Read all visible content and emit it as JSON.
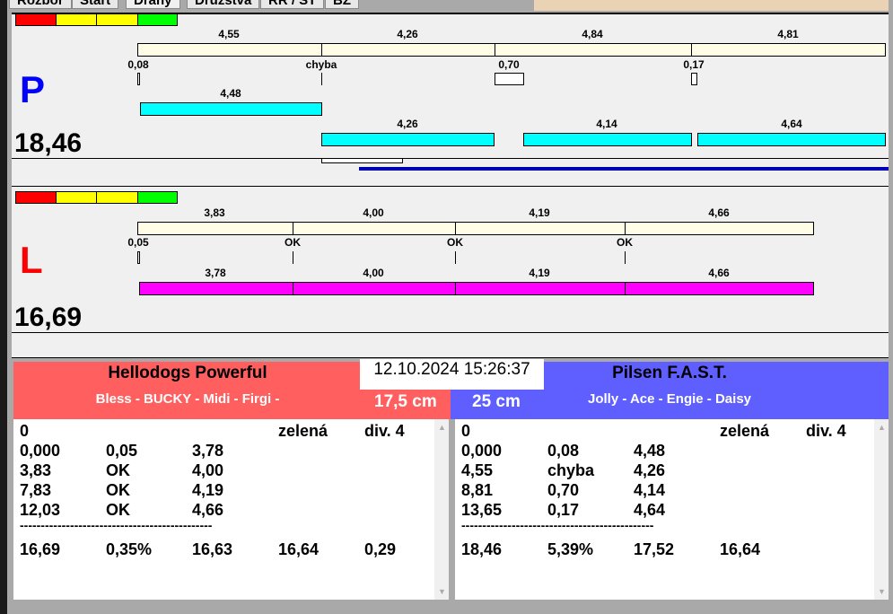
{
  "tabs": [
    "Rozbor",
    "Start",
    "Dráhy",
    "Družstva",
    "RR / ST",
    "BZ"
  ],
  "colors": {
    "red": "#ff0000",
    "yellow": "#ffff00",
    "green": "#00ff00",
    "lane_p": "#0000ff",
    "lane_l": "#ff0000",
    "cyan": "#00ffff",
    "magenta": "#ff00ff",
    "cream": "#fffde6",
    "team_left_bg": "#ff5f5f",
    "team_right_bg": "#5f5fff"
  },
  "lane_p": {
    "letter": "P",
    "total": "18,46",
    "top_values": [
      "4,55",
      "4,26",
      "4,84",
      "4,81"
    ],
    "checks": [
      "0,08",
      "chyba",
      "0,70",
      "0,17"
    ],
    "row1_values": [
      "4,48"
    ],
    "row2_values": [
      "4,26",
      "4,14",
      "4,64"
    ]
  },
  "lane_l": {
    "letter": "L",
    "total": "16,69",
    "top_values": [
      "3,83",
      "4,00",
      "4,19",
      "4,66"
    ],
    "checks": [
      "0,05",
      "OK",
      "OK",
      "OK"
    ],
    "row_values": [
      "3,78",
      "4,00",
      "4,19",
      "4,66"
    ]
  },
  "datetime": "12.10.2024 15:26:37",
  "left_team": {
    "name": "Hellodogs Powerful",
    "dogs": "Bless - BUCKY - Midi - Firgi -",
    "height": "17,5 cm",
    "header": [
      "0",
      "zelená",
      "div. 4"
    ],
    "rows": [
      [
        "0,000",
        "0,05",
        "3,78"
      ],
      [
        "3,83",
        "OK",
        "4,00"
      ],
      [
        "7,83",
        "OK",
        "4,19"
      ],
      [
        "12,03",
        "OK",
        "4,66"
      ]
    ],
    "separator": "----------------------------------------------",
    "totals": [
      "16,69",
      "0,35%",
      "16,63",
      "16,64",
      "0,29"
    ]
  },
  "right_team": {
    "name": "Pilsen F.A.S.T.",
    "dogs": "Jolly - Ace - Engie - Daisy",
    "height": "25 cm",
    "header": [
      "0",
      "zelená",
      "div. 4"
    ],
    "rows": [
      [
        "0,000",
        "0,08",
        "4,48"
      ],
      [
        "4,55",
        "chyba",
        "4,26"
      ],
      [
        "8,81",
        "0,70",
        "4,14"
      ],
      [
        "13,65",
        "0,17",
        "4,64"
      ]
    ],
    "separator": "----------------------------------------------",
    "totals": [
      "18,46",
      "5,39%",
      "17,52",
      "16,64"
    ]
  }
}
